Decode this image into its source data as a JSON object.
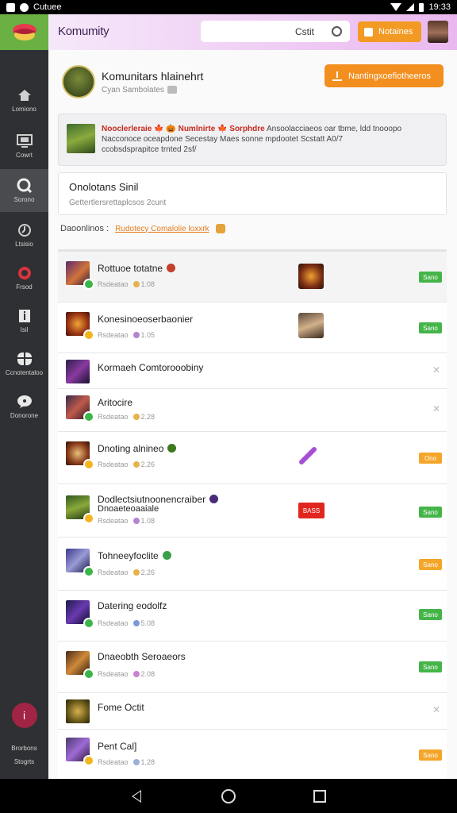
{
  "status_bar": {
    "app_name": "Cutuee",
    "time": "19:33"
  },
  "header": {
    "title": "Komumity",
    "search_text": "Cstit",
    "notify_label": "Notaines"
  },
  "sidebar": {
    "items": [
      {
        "label": "Lomiono",
        "icon": "home-icon"
      },
      {
        "label": "Cowrt",
        "icon": "monitor-icon"
      },
      {
        "label": "Sorono",
        "icon": "search-icon"
      },
      {
        "label": "Ltsisio",
        "icon": "clock-icon"
      },
      {
        "label": "Frsod",
        "icon": "target-icon"
      },
      {
        "label": "Isil",
        "icon": "info-icon"
      },
      {
        "label": "Ccnotentaloo",
        "icon": "grid-icon"
      },
      {
        "label": "Donorone",
        "icon": "chat-icon"
      }
    ],
    "bottom_label_1": "Brorbons",
    "bottom_label_2": "Stogrts"
  },
  "profile": {
    "name": "Komunitars hlainehrt",
    "subtitle": "Cyan Sambolates"
  },
  "join_button_label": "Nantingxoefiotheeros",
  "announcement": {
    "highlight": "Nooclerleraie 🍁 🎃 Numlnirte 🍁 Sorphdre",
    "text_1": "Ansoolacciaeos oar tbme, ldd tnooopo",
    "text_2": "Nacconoce oceapdone Secestay Maes sonne mpdootet Scstatt A0/7",
    "text_3": "ccobsdsprapitce trnted 2sf/"
  },
  "section": {
    "title": "Onolotans Sinil",
    "subtitle": "Gettertlersrettaplcsos 2cunt"
  },
  "filter": {
    "label": "Daoonlinos :",
    "link": "Rudotecy Comalolie loxxrk"
  },
  "rows": [
    {
      "title": "Rottuoe totatne",
      "meta": "Rsdeatao",
      "count": "1.08",
      "badge": "green",
      "status": "Sano",
      "status_color": "green",
      "thumb": "fire",
      "title_dot": "#c4402b"
    },
    {
      "title": "Konesinoeoserbaonier",
      "meta": "Rsdeatao",
      "count": "1.05",
      "badge": "yellow",
      "status": "Sano",
      "status_color": "green",
      "thumb": "mask",
      "title_dot": ""
    },
    {
      "title": "Kormaeh Comtorooobiny",
      "meta": "",
      "count": "",
      "badge": "",
      "status": "",
      "status_color": "",
      "thumb": "",
      "title_dot": ""
    },
    {
      "title": "Aritocire",
      "meta": "Rsdeatao",
      "count": "2.28",
      "badge": "green",
      "status": "",
      "status_color": "",
      "thumb": "",
      "title_dot": ""
    },
    {
      "title": "Dnoting alnineo",
      "meta": "Rsdeatao",
      "count": "2.26",
      "badge": "yellow",
      "status": "Ono",
      "status_color": "orange",
      "thumb": "wand",
      "title_dot": "#3d7a1f"
    },
    {
      "title": "Dodlectsiutnoonencraiber",
      "title_2": "Dnoaeteoaaiale",
      "meta": "Rsdeatao",
      "count": "1.08",
      "badge": "yellow",
      "status": "Sano",
      "status_color": "green",
      "thumb": "red",
      "title_dot": "#4a2b7a"
    },
    {
      "title": "Tohneeyfoclite",
      "meta": "Rsdeatao",
      "count": "2.26",
      "badge": "green",
      "status": "Sano",
      "status_color": "orange",
      "thumb": "",
      "title_dot": "#3aa04a"
    },
    {
      "title": "Datering eodolfz",
      "meta": "Rsdeatao",
      "count": "5.08",
      "badge": "green",
      "status": "Sano",
      "status_color": "green",
      "thumb": "",
      "title_dot": ""
    },
    {
      "title": "Dnaeobth Seroaeors",
      "meta": "Rsdeatao",
      "count": "2.08",
      "badge": "green",
      "status": "Sano",
      "status_color": "green",
      "thumb": "",
      "title_dot": ""
    },
    {
      "title": "Fome Octit",
      "meta": "",
      "count": "",
      "badge": "",
      "status": "",
      "status_color": "",
      "thumb": "",
      "title_dot": ""
    },
    {
      "title": "Pent Cal]",
      "meta": "Rsdeatao",
      "count": "1.28",
      "badge": "yellow",
      "status": "Sano",
      "status_color": "orange",
      "thumb": "",
      "title_dot": ""
    }
  ],
  "red_tag": "BASS"
}
